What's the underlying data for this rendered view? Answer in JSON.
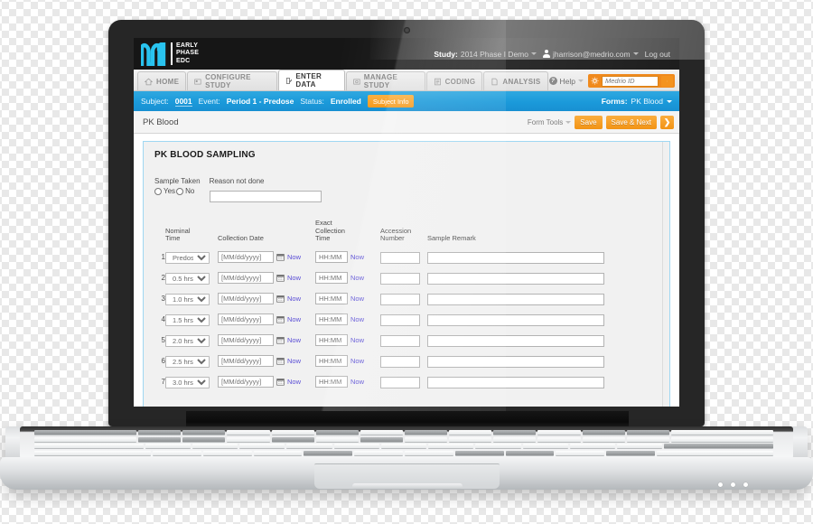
{
  "topbar": {
    "brand_lines": "EARLY\nPHASE\nEDC",
    "brand_line1": "EARLY",
    "brand_line2": "PHASE",
    "brand_line3": "EDC",
    "logo_icon": "m1-logo-icon",
    "study_label": "Study:",
    "study_value": "2014 Phase I Demo",
    "user_icon": "user-icon",
    "user_email": "jharrison@medrio.com",
    "logout": "Log out"
  },
  "nav": {
    "tabs": [
      {
        "label": "HOME",
        "icon": "home-icon",
        "active": false
      },
      {
        "label": "CONFIGURE STUDY",
        "icon": "configure-icon",
        "active": false
      },
      {
        "label": "ENTER DATA",
        "icon": "enter-data-icon",
        "active": true
      },
      {
        "label": "MANAGE STUDY",
        "icon": "manage-study-icon",
        "active": false
      },
      {
        "label": "CODING",
        "icon": "coding-icon",
        "active": false
      },
      {
        "label": "ANALYSIS",
        "icon": "analysis-icon",
        "active": false
      }
    ],
    "help_label": "Help",
    "help_icon": "question-mark-icon",
    "gear_icon": "gear-icon",
    "search_placeholder": "Medrio ID",
    "search_value": "",
    "search_icon": "search-icon"
  },
  "subject_bar": {
    "subject_label": "Subject:",
    "subject_value": "0001",
    "event_label": "Event:",
    "event_value": "Period 1 - Predose",
    "status_label": "Status:",
    "status_value": "Enrolled",
    "subject_info_button": "Subject Info",
    "forms_label": "Forms:",
    "forms_value": "PK Blood"
  },
  "form_bar": {
    "title": "PK Blood",
    "form_tools": "Form Tools",
    "save": "Save",
    "save_next": "Save & Next",
    "next_arrow": "❯"
  },
  "form": {
    "heading": "PK BLOOD SAMPLING",
    "sample_taken_label": "Sample Taken",
    "yes_label": "Yes",
    "no_label": "No",
    "reason_label": "Reason not done",
    "reason_value": "",
    "columns": {
      "index": "",
      "nominal_time": "Nominal\nTime",
      "nominal_time_l1": "Nominal",
      "nominal_time_l2": "Time",
      "collection_date": "Collection Date",
      "exact_time_l1": "Exact",
      "exact_time_l2": "Collection",
      "exact_time_l3": "Time",
      "accession_l1": "Accession",
      "accession_l2": "Number",
      "sample_remark": "Sample Remark"
    },
    "date_placeholder": "[MM/dd/yyyy]",
    "time_placeholder": "HH:MM",
    "now_label": "Now",
    "calendar_icon": "calendar-icon",
    "rows": [
      {
        "n": "1",
        "nominal": "Predose",
        "date": "",
        "time": "",
        "accession": "",
        "remark": ""
      },
      {
        "n": "2",
        "nominal": "0.5 hrs",
        "date": "",
        "time": "",
        "accession": "",
        "remark": ""
      },
      {
        "n": "3",
        "nominal": "1.0 hrs",
        "date": "",
        "time": "",
        "accession": "",
        "remark": ""
      },
      {
        "n": "4",
        "nominal": "1.5 hrs",
        "date": "",
        "time": "",
        "accession": "",
        "remark": ""
      },
      {
        "n": "5",
        "nominal": "2.0 hrs",
        "date": "",
        "time": "",
        "accession": "",
        "remark": ""
      },
      {
        "n": "6",
        "nominal": "2.5 hrs",
        "date": "",
        "time": "",
        "accession": "",
        "remark": ""
      },
      {
        "n": "7",
        "nominal": "3.0 hrs",
        "date": "",
        "time": "",
        "accession": "",
        "remark": ""
      }
    ]
  },
  "colors": {
    "brand_cyan": "#29c3ef",
    "topbar_black": "#161616",
    "subject_blue": "#1b9ada",
    "accent_orange": "#f29314",
    "panel_border_blue": "#9fd7f2",
    "link_purple": "#5b4fd6"
  }
}
